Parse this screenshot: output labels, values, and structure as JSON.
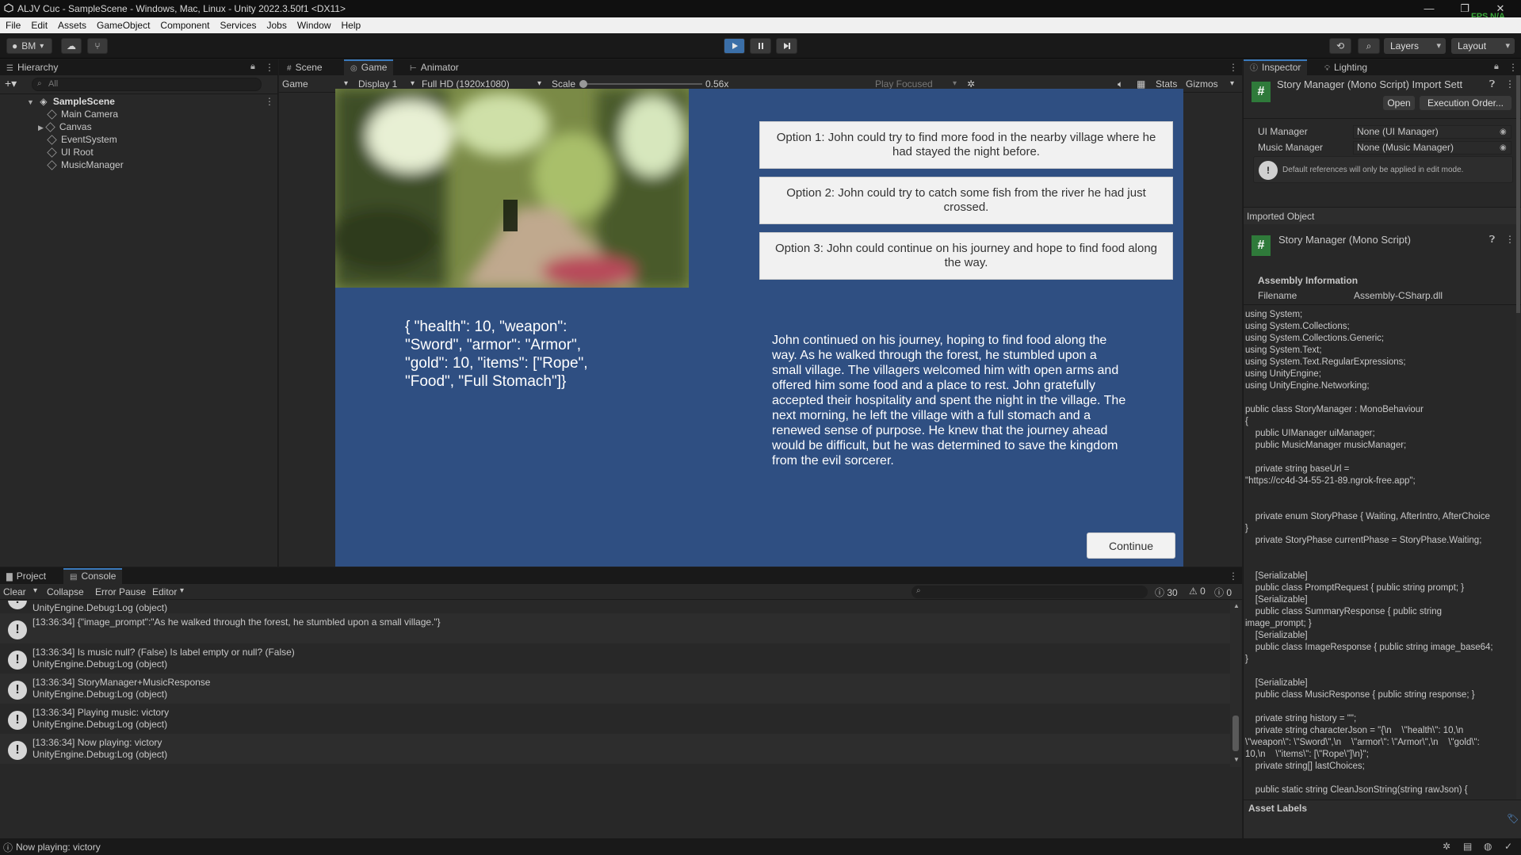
{
  "titlebar": {
    "title": "ALJV Cuc - SampleScene - Windows, Mac, Linux - Unity 2022.3.50f1 <DX11>",
    "minimize": "—",
    "restore": "❐",
    "close": "✕",
    "fps_label": "FPS",
    "fps_value": "N/A"
  },
  "menu": [
    "File",
    "Edit",
    "Assets",
    "GameObject",
    "Component",
    "Services",
    "Jobs",
    "Window",
    "Help"
  ],
  "toolbar": {
    "account": "BM",
    "layers": "Layers",
    "layout": "Layout"
  },
  "hierarchy": {
    "tab": "Hierarchy",
    "search_placeholder": "All",
    "scene": "SampleScene",
    "items": [
      "Main Camera",
      "Canvas",
      "EventSystem",
      "UI Root",
      "MusicManager"
    ]
  },
  "game": {
    "tabs": [
      "Scene",
      "Game",
      "Animator"
    ],
    "mode": "Game",
    "display": "Display 1",
    "resolution": "Full HD (1920x1080)",
    "scale_label": "Scale",
    "scale_value": "0.56x",
    "play_focused": "Play Focused",
    "stats": "Stats",
    "gizmos": "Gizmos",
    "options": [
      "Option 1: John could try to find more food in the nearby village where he had stayed the night before.",
      "Option 2: John could try to catch some fish from the river he had just crossed.",
      "Option 3: John could continue on his journey and hope to find food along the way."
    ],
    "character_json": "{    \"health\": 10,    \"weapon\": \"Sword\",    \"armor\": \"Armor\",    \"gold\": 10,    \"items\": [\"Rope\", \"Food\", \"Full Stomach\"]}",
    "story": "John continued on his journey, hoping to find food along the way. As he walked through the forest, he stumbled upon a small village. The villagers welcomed him with open arms and offered him some food and a place to rest. John gratefully accepted their hospitality and spent the night in the village. The next morning, he left the village with a full stomach and a renewed sense of purpose. He knew that the journey ahead would be difficult, but he was determined to save the kingdom from the evil sorcerer.",
    "continue": "Continue"
  },
  "inspector": {
    "tabs": [
      "Inspector",
      "Lighting"
    ],
    "header_title": "Story Manager (Mono Script) Import Sett",
    "open": "Open",
    "execution_order": "Execution Order...",
    "fields": [
      {
        "label": "UI Manager",
        "value": "None (UI Manager)"
      },
      {
        "label": "Music Manager",
        "value": "None (Music Manager)"
      }
    ],
    "note": "Default references will only be applied in edit mode.",
    "imported_object": "Imported Object",
    "script_name": "Story Manager (Mono Script)",
    "assembly_info": "Assembly Information",
    "filename_label": "Filename",
    "filename_value": "Assembly-CSharp.dll",
    "code": "using System;\nusing System.Collections;\nusing System.Collections.Generic;\nusing System.Text;\nusing System.Text.RegularExpressions;\nusing UnityEngine;\nusing UnityEngine.Networking;\n\npublic class StoryManager : MonoBehaviour\n{\n    public UIManager uiManager;\n    public MusicManager musicManager;\n\n    private string baseUrl =\n\"https://cc4d-34-55-21-89.ngrok-free.app\";\n\n\n    private enum StoryPhase { Waiting, AfterIntro, AfterChoice\n}\n    private StoryPhase currentPhase = StoryPhase.Waiting;\n\n\n    [Serializable]\n    public class PromptRequest { public string prompt; }\n    [Serializable]\n    public class SummaryResponse { public string\nimage_prompt; }\n    [Serializable]\n    public class ImageResponse { public string image_base64;\n}\n\n    [Serializable]\n    public class MusicResponse { public string response; }\n\n    private string history = \"\";\n    private string characterJson = \"{\\n    \\\"health\\\": 10,\\n\n\\\"weapon\\\": \\\"Sword\\\",\\n    \\\"armor\\\": \\\"Armor\\\",\\n    \\\"gold\\\":\n10,\\n    \\\"items\\\": [\\\"Rope\\\"]\\n}\";\n    private string[] lastChoices;\n\n    public static string CleanJsonString(string rawJson) {",
    "asset_labels": "Asset Labels"
  },
  "console": {
    "tabs": [
      "Project",
      "Console"
    ],
    "clear": "Clear",
    "collapse": "Collapse",
    "error_pause": "Error Pause",
    "editor": "Editor",
    "count_logs": "30",
    "count_warnings": "0",
    "count_errors": "0",
    "partial": "UnityEngine.Debug:Log (object)",
    "logs": [
      {
        "msg": "[13:36:34] {\"image_prompt\":\"As he walked through the forest, he stumbled upon a small village.\"}",
        "src": ""
      },
      {
        "msg": "[13:36:34] Is music null? (False) Is label empty or null? (False)",
        "src": "UnityEngine.Debug:Log (object)"
      },
      {
        "msg": "[13:36:34] StoryManager+MusicResponse",
        "src": "UnityEngine.Debug:Log (object)"
      },
      {
        "msg": "[13:36:34] Playing music: victory",
        "src": "UnityEngine.Debug:Log (object)"
      },
      {
        "msg": "[13:36:34] Now playing: victory",
        "src": "UnityEngine.Debug:Log (object)"
      }
    ]
  },
  "status": {
    "text": "Now playing: victory"
  }
}
